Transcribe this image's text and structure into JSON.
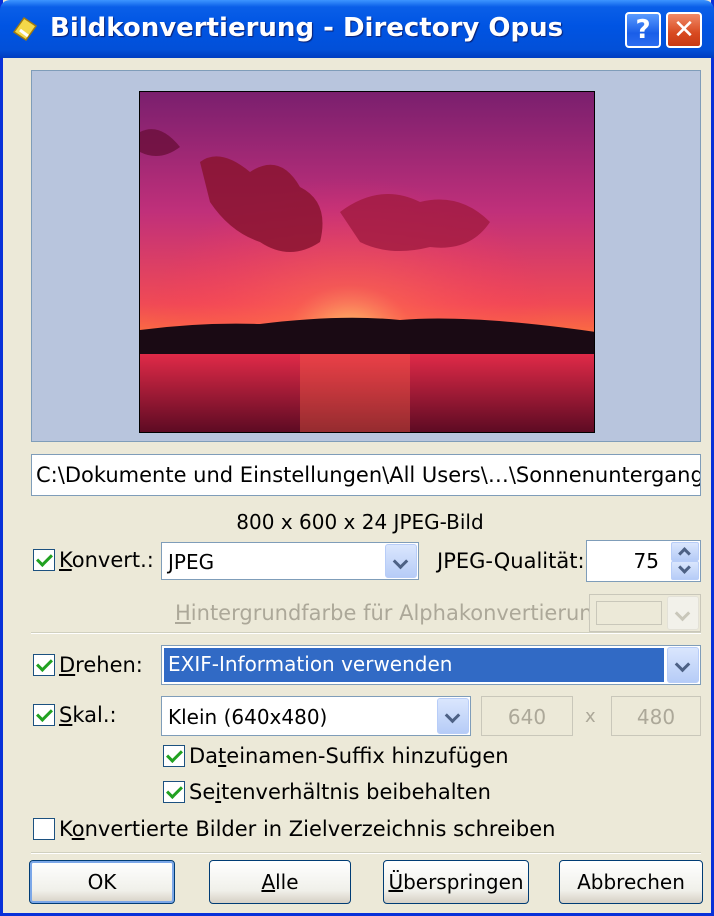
{
  "window": {
    "title": "Bildkonvertierung - Directory Opus",
    "help_label": "?",
    "close_label": "✕"
  },
  "file": {
    "path": "C:\\Dokumente und Einstellungen\\All Users\\…\\Sonnenuntergang.jpg",
    "info": "800 x 600 x 24 JPEG-Bild"
  },
  "convert": {
    "checked": true,
    "label_u": "K",
    "label_rest": "onvert.:",
    "format": "JPEG",
    "quality_label": "JPEG-Qualität:",
    "quality_value": "75",
    "alpha_label_u": "H",
    "alpha_label_rest": "intergrundfarbe für Alphakonvertierung:"
  },
  "rotate": {
    "checked": true,
    "label_u": "D",
    "label_rest": "rehen:",
    "value": "EXIF-Information verwenden"
  },
  "scale": {
    "checked": true,
    "label_u": "S",
    "label_rest": "kal.:",
    "value": "Klein (640x480)",
    "width": "640",
    "separator": "x",
    "height": "480"
  },
  "options": {
    "suffix_checked": true,
    "suffix_pre": "Da",
    "suffix_u": "t",
    "suffix_rest": "einamen-Suffix hinzufügen",
    "aspect_checked": true,
    "aspect_pre": "Se",
    "aspect_u": "i",
    "aspect_rest": "tenverhältnis beibehalten",
    "target_checked": false,
    "target_pre": "K",
    "target_u": "o",
    "target_rest": "nvertierte Bilder in Zielverzeichnis schreiben"
  },
  "buttons": {
    "ok": "OK",
    "all_u": "A",
    "all_rest": "lle",
    "skip_u": "Ü",
    "skip_rest": "berspringen",
    "cancel": "Abbrechen"
  },
  "colors": {
    "titlebar": "#0054e3",
    "selection": "#316ac5",
    "check": "#21a121"
  }
}
